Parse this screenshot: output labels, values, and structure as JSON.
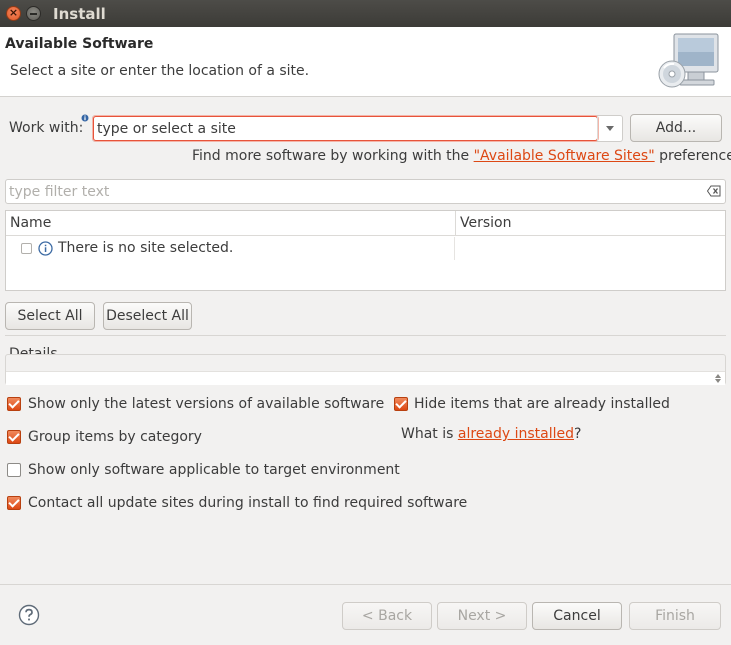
{
  "window": {
    "title": "Install",
    "close_glyph": "×"
  },
  "banner": {
    "title": "Available Software",
    "description": "Select a site or enter the location of a site.",
    "icon": "monitor-cd-icon"
  },
  "work_with": {
    "label": "Work with:",
    "hint_icon": "info-small-icon",
    "value": "type or select a site",
    "add_button": "Add..."
  },
  "find_more": {
    "prefix": "Find more software by working with the ",
    "link": "\"Available Software Sites\"",
    "suffix": " preferences."
  },
  "filter": {
    "placeholder": "type filter text",
    "clear_icon": "clear-filter-icon"
  },
  "table": {
    "columns": [
      "Name",
      "Version"
    ],
    "rows": [
      {
        "name": "There is no site selected.",
        "version": "",
        "checked": false,
        "icon": "info-icon"
      }
    ]
  },
  "selection_buttons": {
    "select_all": "Select All",
    "deselect_all": "Deselect All"
  },
  "details": {
    "label": "Details",
    "text": ""
  },
  "options": [
    {
      "label": "Show only the latest versions of available software",
      "checked": true
    },
    {
      "label": "Group items by category",
      "checked": true
    },
    {
      "label": "Show only software applicable to target environment",
      "checked": false
    },
    {
      "label": "Contact all update sites during install to find required software",
      "checked": true
    },
    {
      "label": "Hide items that are already installed",
      "checked": true
    }
  ],
  "already_installed": {
    "prefix": "What is ",
    "link": "already installed",
    "suffix": "?"
  },
  "footer": {
    "help_icon": "help-icon",
    "back": "< Back",
    "next": "Next >",
    "cancel": "Cancel",
    "finish": "Finish"
  },
  "colors": {
    "accent": "#dd4814",
    "titlebar": "#3c3b37",
    "background": "#f2f1f0"
  }
}
